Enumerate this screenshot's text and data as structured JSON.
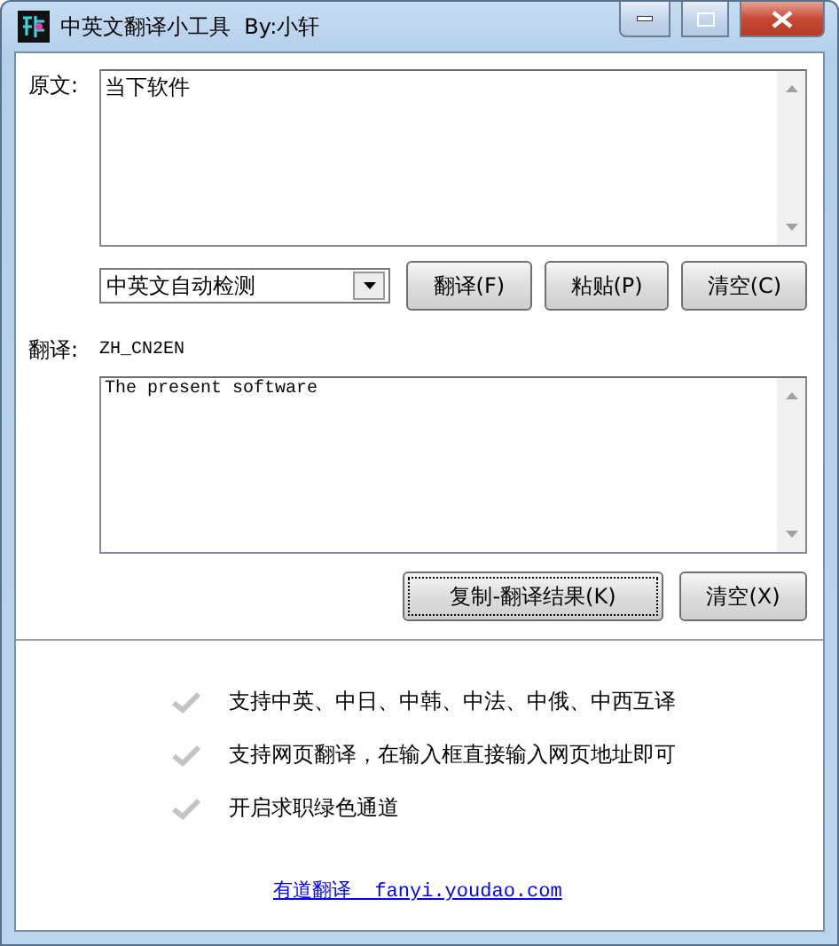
{
  "window": {
    "title": "中英文翻译小工具  By:小轩"
  },
  "source": {
    "label": "原文:",
    "value": "当下软件"
  },
  "mode": {
    "value": "中英文自动检测"
  },
  "source_buttons": [
    "翻译(F)",
    "粘贴(P)",
    "清空(C)"
  ],
  "result": {
    "label": "翻译:",
    "direction": "ZH_CN2EN",
    "value": "The present software"
  },
  "result_buttons": [
    {
      "label": "复制-翻译结果(K)",
      "focused": true
    },
    {
      "label": "清空(X)",
      "focused": false
    }
  ],
  "features": [
    "支持中英、中日、中韩、中法、中俄、中西互译",
    "支持网页翻译，在输入框直接输入网页地址即可",
    "开启求职绿色通道"
  ],
  "link": "有道翻译  fanyi.youdao.com"
}
